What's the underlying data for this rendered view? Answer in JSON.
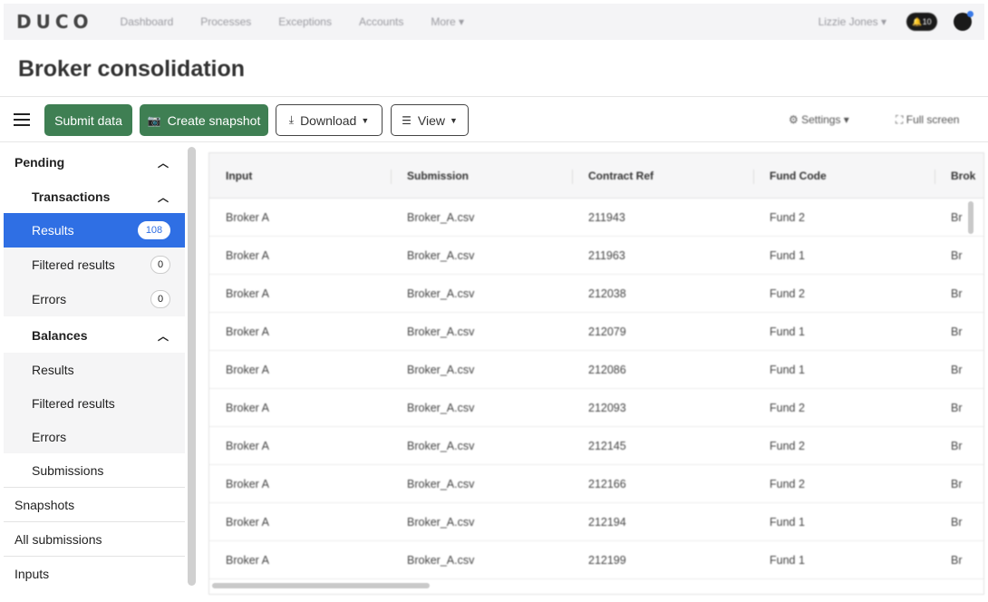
{
  "nav": {
    "logo": "DUCO",
    "links": [
      "Dashboard",
      "Processes",
      "Exceptions",
      "Accounts",
      "More ▾"
    ],
    "user": "Lizzie Jones ▾",
    "bell_badge": "10"
  },
  "page": {
    "title": "Broker consolidation"
  },
  "toolbar": {
    "submit_label": "Submit data",
    "snapshot_label": "Create snapshot",
    "download_label": "Download",
    "view_label": "View",
    "settings_label": "Settings ▾",
    "fullscreen_label": "Full screen"
  },
  "sidebar": {
    "pending": "Pending",
    "transactions": "Transactions",
    "tx_results": "Results",
    "tx_results_count": "108",
    "tx_filtered": "Filtered results",
    "tx_filtered_count": "0",
    "tx_errors": "Errors",
    "tx_errors_count": "0",
    "balances": "Balances",
    "bal_results": "Results",
    "bal_filtered": "Filtered results",
    "bal_errors": "Errors",
    "submissions": "Submissions",
    "snapshots": "Snapshots",
    "all_submissions": "All submissions",
    "inputs": "Inputs"
  },
  "table": {
    "headers": [
      "Input",
      "Submission",
      "Contract Ref",
      "Fund Code",
      "Brok"
    ],
    "rows": [
      [
        "Broker A",
        "Broker_A.csv",
        "211943",
        "Fund 2",
        "Br"
      ],
      [
        "Broker A",
        "Broker_A.csv",
        "211963",
        "Fund 1",
        "Br"
      ],
      [
        "Broker A",
        "Broker_A.csv",
        "212038",
        "Fund 2",
        "Br"
      ],
      [
        "Broker A",
        "Broker_A.csv",
        "212079",
        "Fund 1",
        "Br"
      ],
      [
        "Broker A",
        "Broker_A.csv",
        "212086",
        "Fund 1",
        "Br"
      ],
      [
        "Broker A",
        "Broker_A.csv",
        "212093",
        "Fund 2",
        "Br"
      ],
      [
        "Broker A",
        "Broker_A.csv",
        "212145",
        "Fund 2",
        "Br"
      ],
      [
        "Broker A",
        "Broker_A.csv",
        "212166",
        "Fund 2",
        "Br"
      ],
      [
        "Broker A",
        "Broker_A.csv",
        "212194",
        "Fund 1",
        "Br"
      ],
      [
        "Broker A",
        "Broker_A.csv",
        "212199",
        "Fund 1",
        "Br"
      ]
    ]
  }
}
